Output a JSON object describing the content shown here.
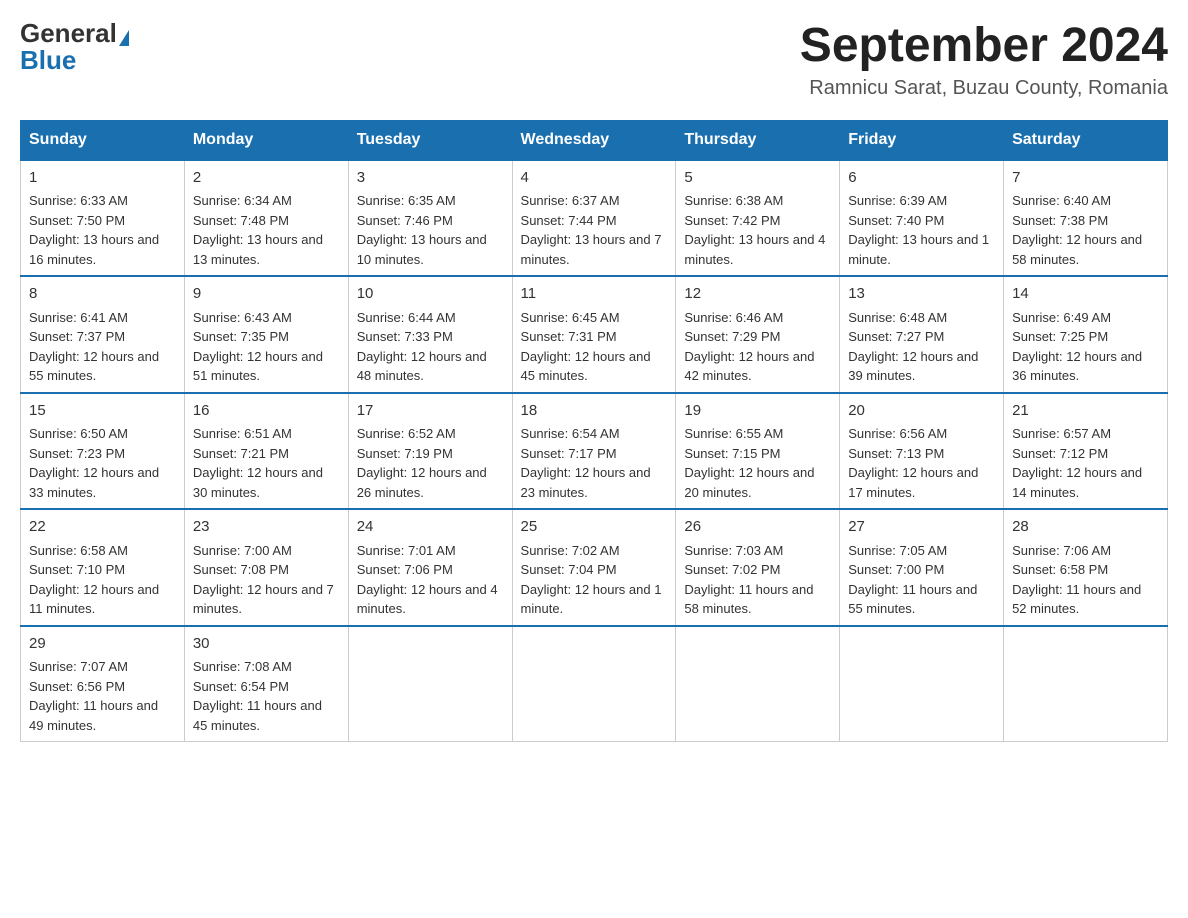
{
  "header": {
    "logo_general": "General",
    "logo_blue": "Blue",
    "month_title": "September 2024",
    "location": "Ramnicu Sarat, Buzau County, Romania"
  },
  "days_of_week": [
    "Sunday",
    "Monday",
    "Tuesday",
    "Wednesday",
    "Thursday",
    "Friday",
    "Saturday"
  ],
  "weeks": [
    [
      {
        "day": "1",
        "sunrise": "6:33 AM",
        "sunset": "7:50 PM",
        "daylight": "13 hours and 16 minutes."
      },
      {
        "day": "2",
        "sunrise": "6:34 AM",
        "sunset": "7:48 PM",
        "daylight": "13 hours and 13 minutes."
      },
      {
        "day": "3",
        "sunrise": "6:35 AM",
        "sunset": "7:46 PM",
        "daylight": "13 hours and 10 minutes."
      },
      {
        "day": "4",
        "sunrise": "6:37 AM",
        "sunset": "7:44 PM",
        "daylight": "13 hours and 7 minutes."
      },
      {
        "day": "5",
        "sunrise": "6:38 AM",
        "sunset": "7:42 PM",
        "daylight": "13 hours and 4 minutes."
      },
      {
        "day": "6",
        "sunrise": "6:39 AM",
        "sunset": "7:40 PM",
        "daylight": "13 hours and 1 minute."
      },
      {
        "day": "7",
        "sunrise": "6:40 AM",
        "sunset": "7:38 PM",
        "daylight": "12 hours and 58 minutes."
      }
    ],
    [
      {
        "day": "8",
        "sunrise": "6:41 AM",
        "sunset": "7:37 PM",
        "daylight": "12 hours and 55 minutes."
      },
      {
        "day": "9",
        "sunrise": "6:43 AM",
        "sunset": "7:35 PM",
        "daylight": "12 hours and 51 minutes."
      },
      {
        "day": "10",
        "sunrise": "6:44 AM",
        "sunset": "7:33 PM",
        "daylight": "12 hours and 48 minutes."
      },
      {
        "day": "11",
        "sunrise": "6:45 AM",
        "sunset": "7:31 PM",
        "daylight": "12 hours and 45 minutes."
      },
      {
        "day": "12",
        "sunrise": "6:46 AM",
        "sunset": "7:29 PM",
        "daylight": "12 hours and 42 minutes."
      },
      {
        "day": "13",
        "sunrise": "6:48 AM",
        "sunset": "7:27 PM",
        "daylight": "12 hours and 39 minutes."
      },
      {
        "day": "14",
        "sunrise": "6:49 AM",
        "sunset": "7:25 PM",
        "daylight": "12 hours and 36 minutes."
      }
    ],
    [
      {
        "day": "15",
        "sunrise": "6:50 AM",
        "sunset": "7:23 PM",
        "daylight": "12 hours and 33 minutes."
      },
      {
        "day": "16",
        "sunrise": "6:51 AM",
        "sunset": "7:21 PM",
        "daylight": "12 hours and 30 minutes."
      },
      {
        "day": "17",
        "sunrise": "6:52 AM",
        "sunset": "7:19 PM",
        "daylight": "12 hours and 26 minutes."
      },
      {
        "day": "18",
        "sunrise": "6:54 AM",
        "sunset": "7:17 PM",
        "daylight": "12 hours and 23 minutes."
      },
      {
        "day": "19",
        "sunrise": "6:55 AM",
        "sunset": "7:15 PM",
        "daylight": "12 hours and 20 minutes."
      },
      {
        "day": "20",
        "sunrise": "6:56 AM",
        "sunset": "7:13 PM",
        "daylight": "12 hours and 17 minutes."
      },
      {
        "day": "21",
        "sunrise": "6:57 AM",
        "sunset": "7:12 PM",
        "daylight": "12 hours and 14 minutes."
      }
    ],
    [
      {
        "day": "22",
        "sunrise": "6:58 AM",
        "sunset": "7:10 PM",
        "daylight": "12 hours and 11 minutes."
      },
      {
        "day": "23",
        "sunrise": "7:00 AM",
        "sunset": "7:08 PM",
        "daylight": "12 hours and 7 minutes."
      },
      {
        "day": "24",
        "sunrise": "7:01 AM",
        "sunset": "7:06 PM",
        "daylight": "12 hours and 4 minutes."
      },
      {
        "day": "25",
        "sunrise": "7:02 AM",
        "sunset": "7:04 PM",
        "daylight": "12 hours and 1 minute."
      },
      {
        "day": "26",
        "sunrise": "7:03 AM",
        "sunset": "7:02 PM",
        "daylight": "11 hours and 58 minutes."
      },
      {
        "day": "27",
        "sunrise": "7:05 AM",
        "sunset": "7:00 PM",
        "daylight": "11 hours and 55 minutes."
      },
      {
        "day": "28",
        "sunrise": "7:06 AM",
        "sunset": "6:58 PM",
        "daylight": "11 hours and 52 minutes."
      }
    ],
    [
      {
        "day": "29",
        "sunrise": "7:07 AM",
        "sunset": "6:56 PM",
        "daylight": "11 hours and 49 minutes."
      },
      {
        "day": "30",
        "sunrise": "7:08 AM",
        "sunset": "6:54 PM",
        "daylight": "11 hours and 45 minutes."
      },
      null,
      null,
      null,
      null,
      null
    ]
  ]
}
